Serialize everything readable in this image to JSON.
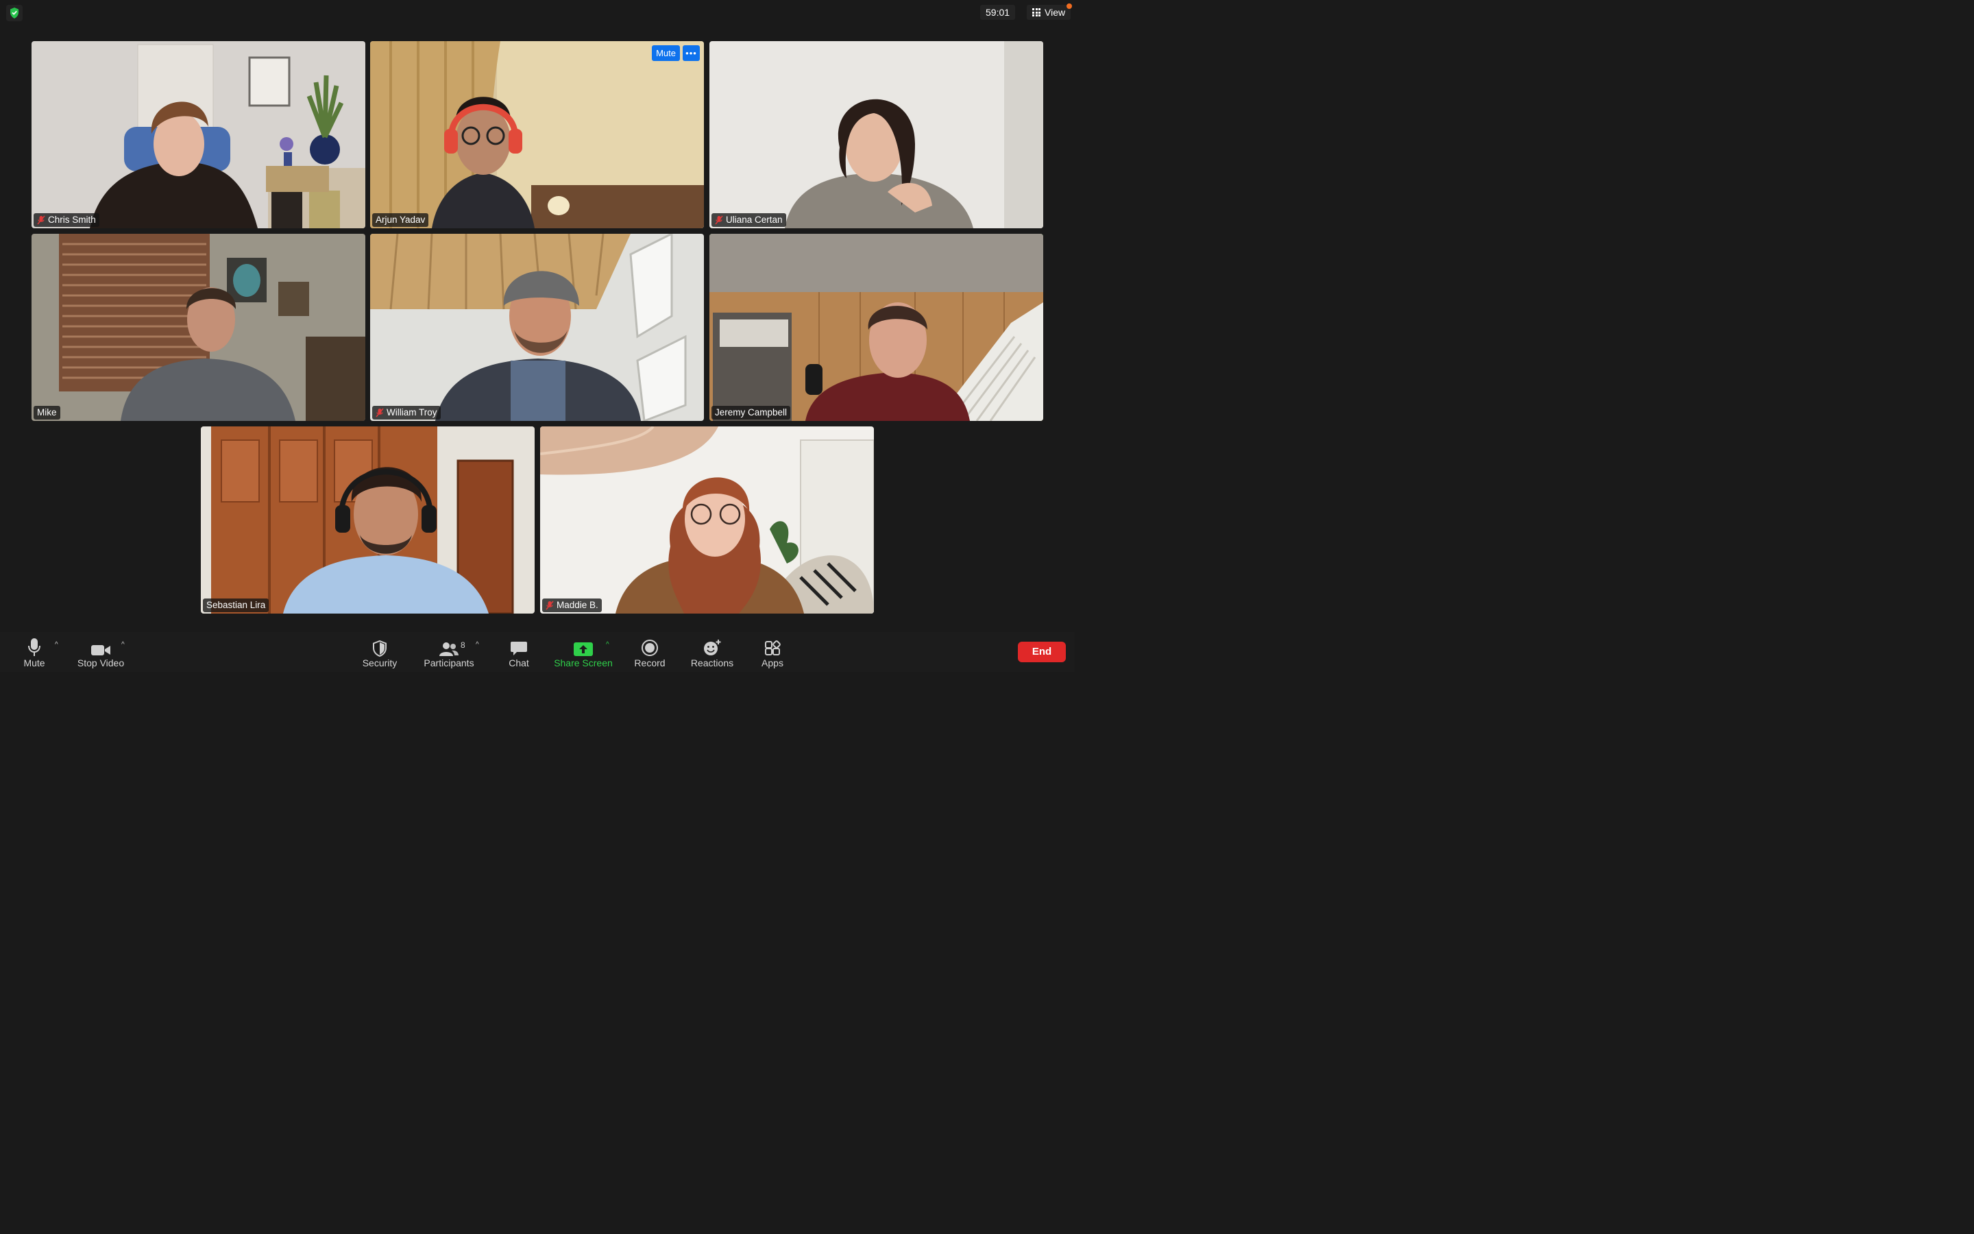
{
  "top": {
    "timer": "59:01",
    "view_label": "View"
  },
  "participants": [
    {
      "name": "Chris Smith",
      "muted": true
    },
    {
      "name": "Arjun Yadav",
      "muted": false,
      "hover_mute": "Mute",
      "more": "•••"
    },
    {
      "name": "Uliana Certan",
      "muted": true
    },
    {
      "name": "Mike",
      "muted": false
    },
    {
      "name": "William Troy",
      "muted": true
    },
    {
      "name": "Jeremy Campbell",
      "muted": false,
      "active_speaker": true
    },
    {
      "name": "Sebastian Lira",
      "muted": false
    },
    {
      "name": "Maddie B.",
      "muted": true
    }
  ],
  "toolbar": {
    "mute": "Mute",
    "stop_video": "Stop Video",
    "security": "Security",
    "participants": "Participants",
    "participants_count": "8",
    "chat": "Chat",
    "share_screen": "Share Screen",
    "record": "Record",
    "reactions": "Reactions",
    "apps": "Apps",
    "end": "End"
  },
  "colors": {
    "accent_blue": "#0e72ed",
    "share_green": "#2fd04a",
    "end_red": "#e02828",
    "active_border": "#2fd04a"
  }
}
